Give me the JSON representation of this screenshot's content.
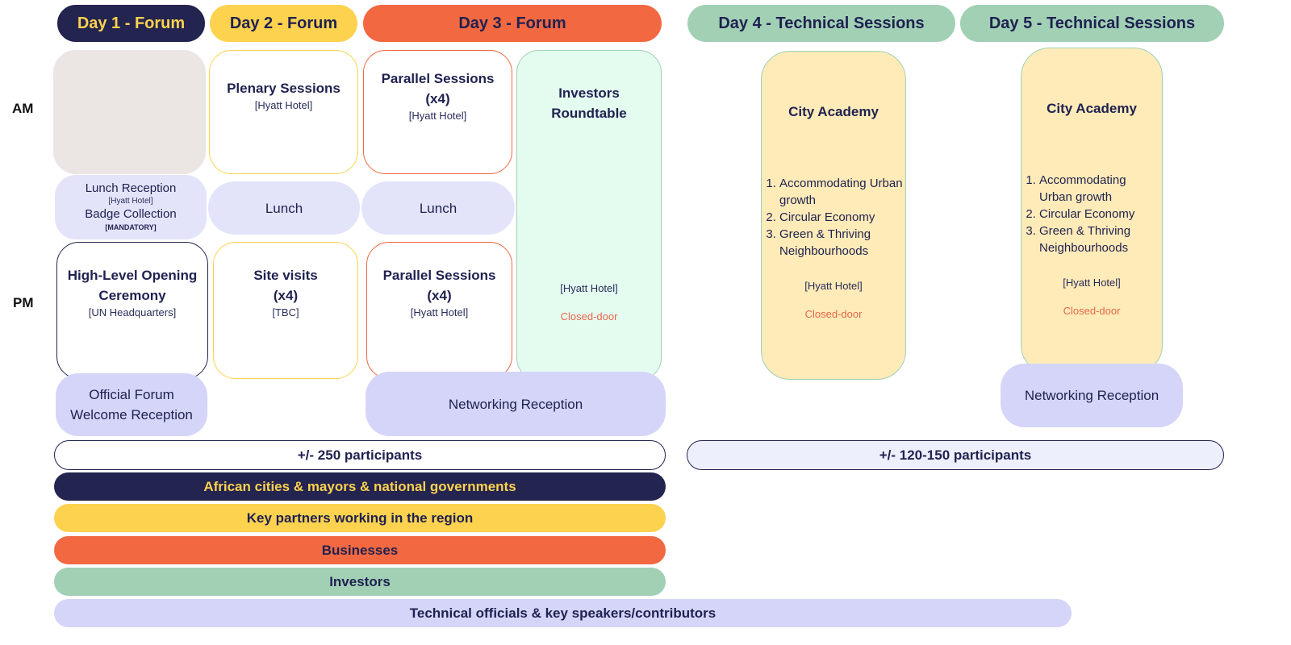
{
  "colors": {
    "navy": "#23244f",
    "yellow": "#fdd24f",
    "orange": "#f26841",
    "green": "#a1d0b5",
    "lavender": "#d4d5f8",
    "lavender_light": "#e3e4fa",
    "grey": "#ebe5e3",
    "mint": "#e4fcef",
    "cream": "#feebb8",
    "closed_red": "#e8674a"
  },
  "row_labels": {
    "am": "AM",
    "pm": "PM"
  },
  "days": [
    {
      "label": "Day 1 - Forum"
    },
    {
      "label": "Day 2 - Forum"
    },
    {
      "label": "Day 3 - Forum"
    },
    {
      "label": "Day 4 - Technical Sessions"
    },
    {
      "label": "Day 5 - Technical Sessions"
    }
  ],
  "day1": {
    "lunch": {
      "line1": "Lunch Reception",
      "venue1": "[Hyatt Hotel]",
      "line2": "Badge Collection",
      "note": "[MANDATORY]"
    },
    "pm": {
      "title_line1": "High-Level Opening",
      "title_line2": "Ceremony",
      "venue": "[UN Headquarters]"
    },
    "evening": {
      "line1": "Official Forum",
      "line2": "Welcome Reception"
    }
  },
  "day2": {
    "am": {
      "title": "Plenary Sessions",
      "venue": "[Hyatt Hotel]"
    },
    "lunch": "Lunch",
    "pm": {
      "title_line1": "Site visits",
      "title_line2": "(x4)",
      "venue": "[TBC]"
    }
  },
  "day3": {
    "am": {
      "title_line1": "Parallel Sessions",
      "title_line2": "(x4)",
      "venue": "[Hyatt Hotel]"
    },
    "lunch": "Lunch",
    "pm": {
      "title_line1": "Parallel Sessions",
      "title_line2": "(x4)",
      "venue": "[Hyatt Hotel]"
    },
    "investors": {
      "title_line1": "Investors",
      "title_line2": "Roundtable",
      "venue": "[Hyatt Hotel]",
      "status": "Closed-door"
    },
    "evening": "Networking Reception"
  },
  "day4": {
    "academy": {
      "title": "City Academy",
      "topics": [
        "Accommodating Urban growth",
        "Circular Economy",
        "Green & Thriving Neighbourhoods"
      ],
      "venue": "[Hyatt Hotel]",
      "status": "Closed-door"
    }
  },
  "day5": {
    "academy": {
      "title": "City Academy",
      "topics": [
        "Accommodating Urban growth",
        "Circular Economy",
        "Green & Thriving Neighbourhoods"
      ],
      "venue": "[Hyatt Hotel]",
      "status": "Closed-door"
    },
    "evening": "Networking Reception"
  },
  "participants": {
    "forum": "+/- 250 participants",
    "technical": "+/- 120-150 participants"
  },
  "audience_bands": [
    {
      "label": "African cities & mayors &  national governments"
    },
    {
      "label": "Key partners working in the region"
    },
    {
      "label": "Businesses"
    },
    {
      "label": "Investors"
    },
    {
      "label": "Technical officials & key speakers/contributors"
    }
  ]
}
